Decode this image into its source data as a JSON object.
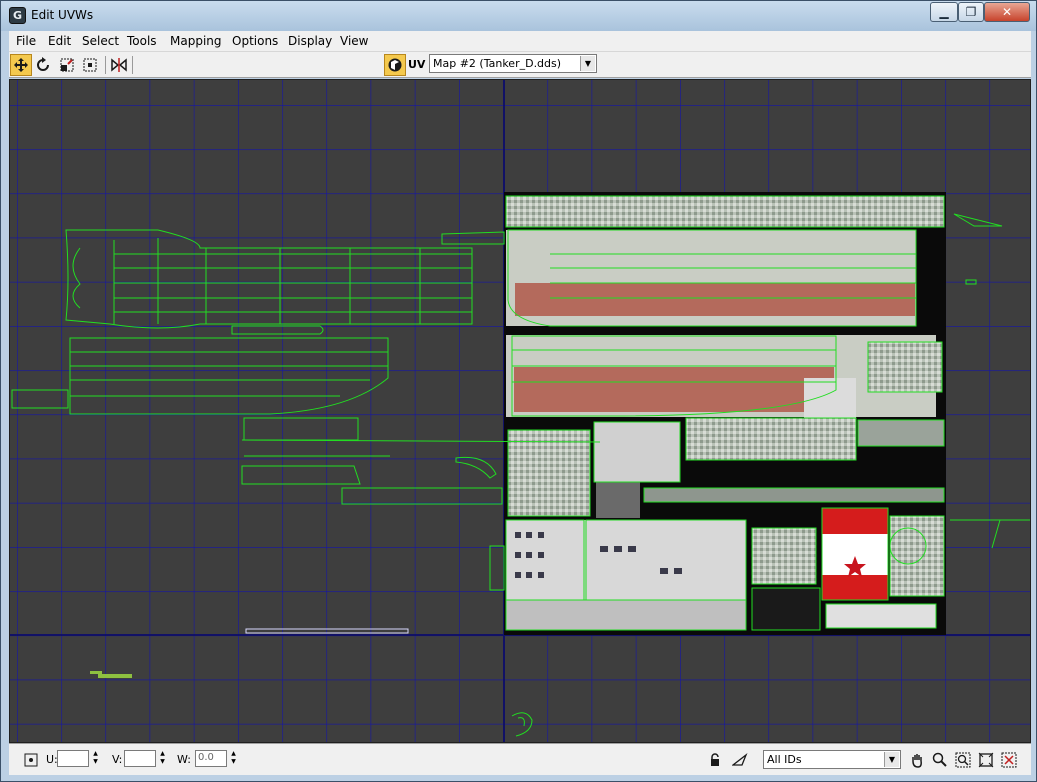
{
  "window": {
    "title": "Edit UVWs",
    "app_icon_letter": "G",
    "min_glyph": "▁",
    "max_glyph": "❐",
    "close_glyph": "✕"
  },
  "menu": {
    "items": [
      "File",
      "Edit",
      "Select",
      "Tools",
      "Mapping",
      "Options",
      "Display",
      "View"
    ]
  },
  "toolbar": {
    "tools": [
      "move-icon",
      "rotate-icon",
      "scale-icon",
      "freeform-icon",
      "mirror-icon"
    ],
    "active_tool": "move-icon",
    "uv_label": "UV",
    "map_selected": "Map #2 (Tanker_D.dds)",
    "dropdown_arrow": "▼"
  },
  "statusbar": {
    "u_label": "U:",
    "v_label": "V:",
    "w_label": "W:",
    "u_value": "",
    "v_value": "",
    "w_value": "0.0",
    "spin_up": "▲",
    "spin_down": "▼",
    "ids_selected": "All IDs",
    "tools": [
      "lock-icon",
      "paint-select-icon",
      "pan-hand-icon",
      "zoom-icon",
      "zoom-region-icon",
      "zoom-extents-icon",
      "filter-icon"
    ]
  },
  "colors": {
    "viewport_bg": "#3e3e3e",
    "grid": "#1414a8",
    "uv_wire": "#22dd22",
    "titlebar": "#b4cbe0",
    "star": "#c8141e"
  }
}
